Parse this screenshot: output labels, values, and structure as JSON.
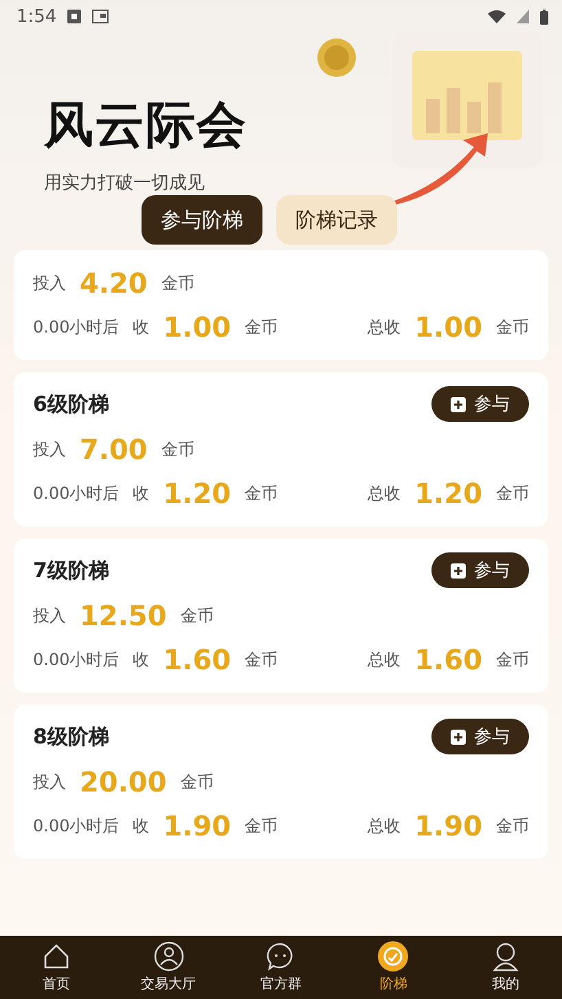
{
  "status_bar": {
    "time": "1:54"
  },
  "hero": {
    "title": "风云际会",
    "subtitle": "用实力打破一切成见"
  },
  "tabs": [
    {
      "label": "参与阶梯",
      "selected": true
    },
    {
      "label": "阶梯记录",
      "selected": false
    }
  ],
  "ladders": [
    {
      "invest_label": "投入",
      "invest": "4.20",
      "unit": "金币",
      "delay": "0.00小时后",
      "receive_label": "收",
      "receive": "1.00",
      "receive_unit": "金币",
      "total_label": "总收",
      "total": "1.00",
      "total_unit": "金币"
    },
    {
      "title": "6级阶梯",
      "button": "参与",
      "invest_label": "投入",
      "invest": "7.00",
      "unit": "金币",
      "delay": "0.00小时后",
      "receive_label": "收",
      "receive": "1.20",
      "receive_unit": "金币",
      "total_label": "总收",
      "total": "1.20",
      "total_unit": "金币"
    },
    {
      "title": "7级阶梯",
      "button": "参与",
      "invest_label": "投入",
      "invest": "12.50",
      "unit": "金币",
      "delay": "0.00小时后",
      "receive_label": "收",
      "receive": "1.60",
      "receive_unit": "金币",
      "total_label": "总收",
      "total": "1.60",
      "total_unit": "金币"
    },
    {
      "title": "8级阶梯",
      "button": "参与",
      "invest_label": "投入",
      "invest": "20.00",
      "unit": "金币",
      "delay": "0.00小时后",
      "receive_label": "收",
      "receive": "1.90",
      "receive_unit": "金币",
      "total_label": "总收",
      "total": "1.90",
      "total_unit": "金币"
    }
  ],
  "nav": [
    {
      "kind": "home",
      "label": "首页",
      "selected": false
    },
    {
      "kind": "market",
      "label": "交易大厅",
      "selected": false
    },
    {
      "kind": "chat",
      "label": "官方群",
      "selected": false
    },
    {
      "kind": "ladder",
      "label": "阶梯",
      "selected": true
    },
    {
      "kind": "user",
      "label": "我的",
      "selected": false
    }
  ]
}
